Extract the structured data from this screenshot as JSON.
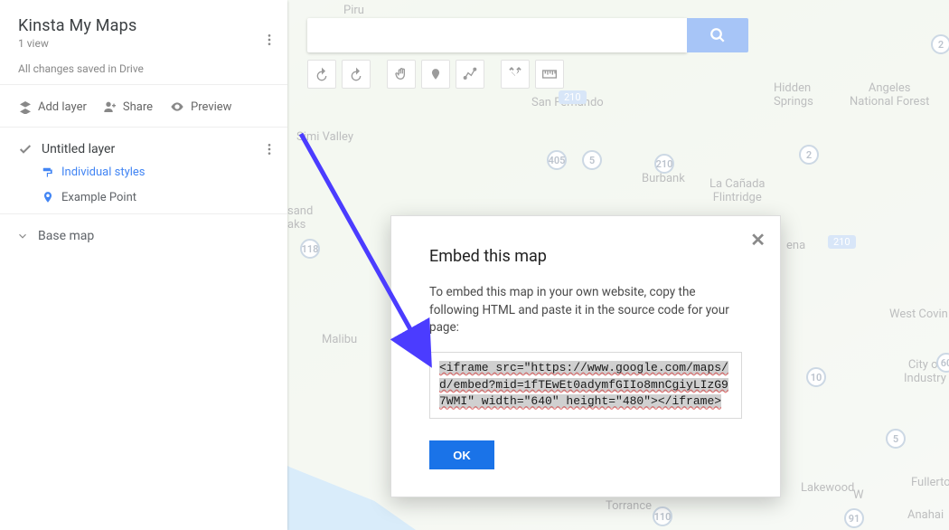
{
  "panel": {
    "title": "Kinsta My Maps",
    "views": "1 view",
    "saved_status": "All changes saved in Drive",
    "add_layer": "Add layer",
    "share": "Share",
    "preview": "Preview",
    "layer": {
      "name": "Untitled layer",
      "styles": "Individual styles",
      "point": "Example Point"
    },
    "base_map": "Base map"
  },
  "search": {
    "placeholder": ""
  },
  "modal": {
    "title": "Embed this map",
    "body": "To embed this map in your own website, copy the following HTML and paste it in the source code for your page:",
    "embed_code": "<iframe src=\"https://www.google.com/maps/d/embed?mid=1fTEwEt0adymfGIIo8mnCgiyLIzG97WMI\" width=\"640\" height=\"480\"></iframe>",
    "ok": "OK"
  },
  "map_labels": {
    "piru": "Piru",
    "simi": "Simi Valley",
    "sand": "sand\naks",
    "sanfernando": "San Fernando",
    "malibu": "Malibu",
    "burbank": "Burbank",
    "lacanada": "La Cañada\nFlintridge",
    "hidden": "Hidden\nSprings",
    "angeles": "Angeles\nNational Forest",
    "ena": "ena",
    "westcovin": "West Covin",
    "industry": "City of\nIndustry",
    "fullerto": "Fullerto",
    "anahai": "Anahai",
    "lakewood": "Lakewood",
    "torrance": "Torrance",
    "w": "W"
  }
}
